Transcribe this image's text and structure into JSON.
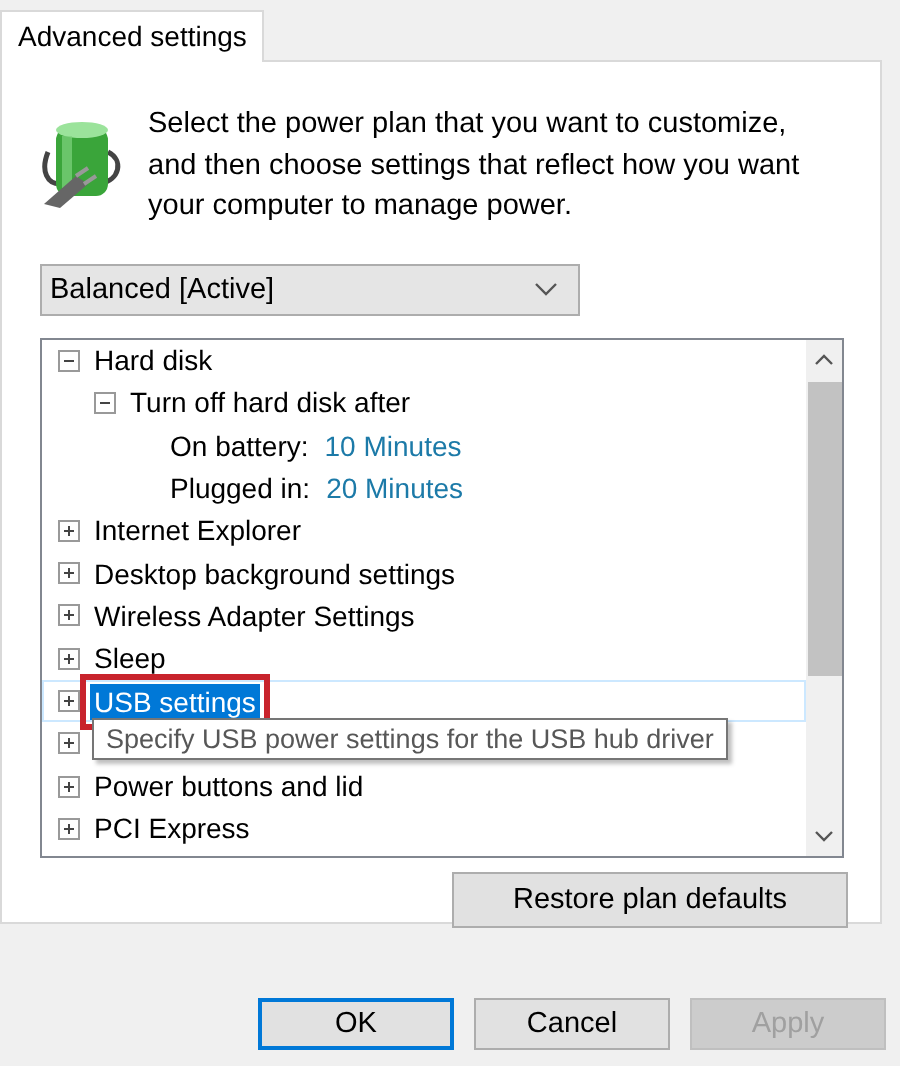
{
  "tabs": [
    {
      "label": "Advanced settings",
      "selected": true
    }
  ],
  "intro": "Select the power plan that you want to customize, and then choose settings that reflect how you want your computer to manage power.",
  "plan_dropdown": {
    "value": "Balanced [Active]"
  },
  "tree": [
    {
      "label": "Hard disk",
      "expanded": true,
      "selected": false,
      "children": [
        {
          "label": "Turn off hard disk after",
          "expanded": true,
          "selected": false,
          "children": [
            {
              "label": "On battery:",
              "value": "10 Minutes",
              "selected": false
            },
            {
              "label": "Plugged in:",
              "value": "20 Minutes",
              "selected": false
            }
          ]
        }
      ]
    },
    {
      "label": "Internet Explorer",
      "expanded": false,
      "selected": false
    },
    {
      "label": "Desktop background settings",
      "expanded": false,
      "selected": false
    },
    {
      "label": "Wireless Adapter Settings",
      "expanded": false,
      "selected": false
    },
    {
      "label": "Sleep",
      "expanded": false,
      "selected": false
    },
    {
      "label": "USB settings",
      "expanded": false,
      "selected": true,
      "outlined": true
    },
    {
      "expanded": false,
      "selected": false
    },
    {
      "label": "Power buttons and lid",
      "expanded": false,
      "selected": false
    },
    {
      "label": "PCI Express",
      "expanded": false,
      "selected": false
    }
  ],
  "tooltip": "Specify USB power settings for the USB hub driver",
  "restore_button": "Restore plan defaults",
  "buttons": [
    {
      "label": "OK",
      "kind": "default",
      "disabled": false
    },
    {
      "label": "Cancel",
      "kind": "normal",
      "disabled": false
    },
    {
      "label": "Apply",
      "kind": "normal",
      "disabled": true
    }
  ]
}
